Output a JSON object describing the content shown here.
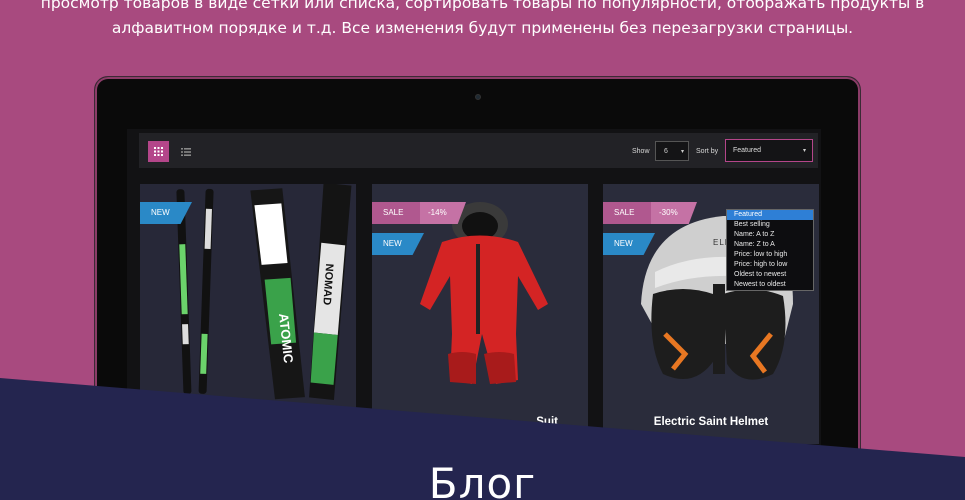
{
  "intro": {
    "line1": "просмотр товаров в виде сетки или списка, сортировать товары по популярности, отображать продукты в",
    "line2": "алфавитном порядке и т.д. Все изменения будут применены без перезагрузки страницы."
  },
  "toolbar": {
    "show_label": "Show",
    "show_value": "6",
    "sort_label": "Sort by",
    "sort_value": "Featured"
  },
  "sort_options": [
    "Featured",
    "Best selling",
    "Name: A to Z",
    "Name: Z to A",
    "Price: low to high",
    "Price: high to low",
    "Oldest to newest",
    "Newest to oldest"
  ],
  "products": [
    {
      "badge_new": "NEW"
    },
    {
      "badge_sale": "SALE",
      "badge_discount": "-14%",
      "badge_new": "NEW",
      "name": "Suit"
    },
    {
      "badge_sale": "SALE",
      "badge_discount": "-30%",
      "badge_new": "NEW",
      "name": "Electric Saint Helmet"
    }
  ],
  "helmet_brand_text": "ELECTRIC",
  "ski_brand_text": [
    "ATOMIC",
    "NOMAD"
  ],
  "section": {
    "title": "Блог"
  },
  "colors": {
    "background": "#a84a7f",
    "accent": "#b4468a",
    "new_badge": "#2a89c7",
    "band": "#24254f"
  }
}
